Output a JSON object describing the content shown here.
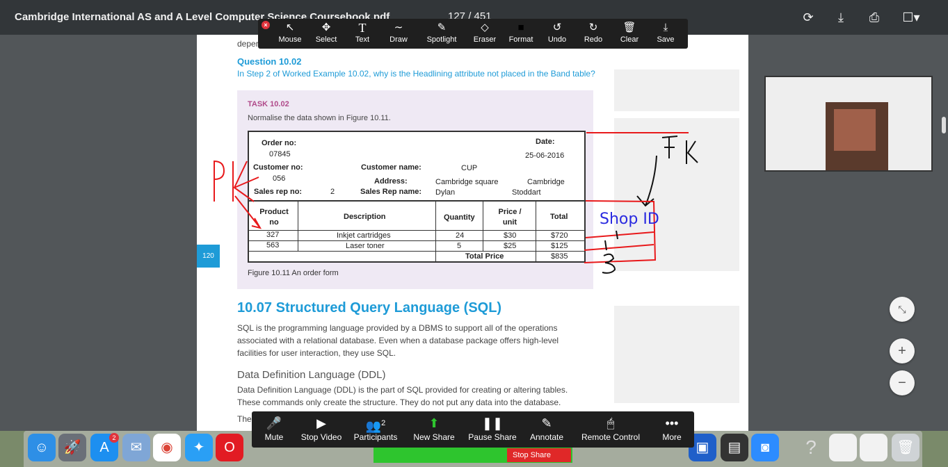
{
  "viewer": {
    "doc_title": "Cambridge International AS and A Level Computer Science Coursebook.pdf",
    "page_current": "127",
    "page_sep": "/",
    "page_total": "451",
    "icons": [
      "rotate-icon",
      "download-icon",
      "print-icon",
      "bookmark-icon"
    ]
  },
  "annotate_toolbar": {
    "items": [
      {
        "label": "Mouse",
        "icon": "↖"
      },
      {
        "label": "Select",
        "icon": "✥"
      },
      {
        "label": "Text",
        "icon": "T"
      },
      {
        "label": "Draw",
        "icon": "∼"
      },
      {
        "label": "Spotlight",
        "icon": "✎"
      },
      {
        "label": "Eraser",
        "icon": "◇"
      },
      {
        "label": "Format",
        "icon": "■"
      },
      {
        "label": "Undo",
        "icon": "↺"
      },
      {
        "label": "Redo",
        "icon": "↻"
      },
      {
        "label": "Clear",
        "icon": "🗑"
      },
      {
        "label": "Save",
        "icon": "⤓"
      }
    ]
  },
  "page": {
    "top_fragment": "deper",
    "question_title": "Question 10.02",
    "question_text": "In Step 2 of Worked Example 10.02, why is the Headlining attribute not placed in the Band table?",
    "task_label": "TASK 10.02",
    "task_text": "Normalise the data shown in Figure 10.11.",
    "figure_caption": "Figure 10.11 An order form",
    "page_number": "120",
    "section_heading": "10.07 Structured Query Language (SQL)",
    "section_body": "SQL is the programming language provided by a DBMS to support all of the operations associated with a relational database. Even when a database package offers high-level facilities for user interaction, they use SQL.",
    "sub_heading": "Data Definition Language (DDL)",
    "sub_body": "Data Definition Language (DDL) is the part of SQL provided for creating or altering tables. These commands only create the structure. They do not put any data into the database.",
    "bottom_fragment": "The"
  },
  "order_form": {
    "order_no_label": "Order no:",
    "order_no": "07845",
    "date_label": "Date:",
    "date": "25-06-2016",
    "customer_no_label": "Customer no:",
    "customer_no": "056",
    "customer_name_label": "Customer name:",
    "customer_name": "CUP",
    "address_label": "Address:",
    "address_1": "Cambridge square",
    "address_2": "Cambridge",
    "sales_rep_no_label": "Sales rep no:",
    "sales_rep_no": "2",
    "sales_rep_name_label": "Sales Rep name:",
    "sales_rep_first": "Dylan",
    "sales_rep_last": "Stoddart",
    "columns": [
      "Product no",
      "Description",
      "Quantity",
      "Price / unit",
      "Total"
    ],
    "rows": [
      {
        "product": "327",
        "description": "Inkjet cartridges",
        "quantity": "24",
        "price": "$30",
        "total": "$720"
      },
      {
        "product": "563",
        "description": "Laser toner",
        "quantity": "5",
        "price": "$25",
        "total": "$125"
      }
    ],
    "total_price_label": "Total Price",
    "total_price": "$835"
  },
  "annotations": {
    "pk": "PK",
    "fk": "FK",
    "shop_id": "Shop ID",
    "one": "1",
    "three": "3",
    "colors": {
      "red": "#e8191b",
      "black": "#111111",
      "blue": "#2a2ae0"
    }
  },
  "zoom_controls": {
    "items": [
      {
        "label": "Mute",
        "icon": "🎤"
      },
      {
        "label": "Stop Video",
        "icon": "▶"
      },
      {
        "label": "Participants",
        "icon": "👥",
        "count": "2"
      },
      {
        "label": "New Share",
        "icon": "⬆"
      },
      {
        "label": "Pause Share",
        "icon": "❚❚"
      },
      {
        "label": "Annotate",
        "icon": "✎"
      },
      {
        "label": "Remote Control",
        "icon": "🖱"
      },
      {
        "label": "More",
        "icon": "•••"
      }
    ],
    "stop_share": "Stop Share",
    "share_color": "#2ec52e",
    "stop_color": "#e02828"
  },
  "dock": {
    "badges": {
      "app_store": "2"
    },
    "apps": [
      "finder-icon",
      "launchpad-icon",
      "app-store-icon",
      "mail-icon",
      "chrome-icon",
      "safari-icon",
      "opera-icon",
      "zoom-icon",
      "help-icon",
      "document-icon",
      "trash-icon"
    ]
  },
  "right_controls": {
    "fit_icon": "⤡",
    "zoom_in": "+",
    "zoom_out": "−"
  }
}
